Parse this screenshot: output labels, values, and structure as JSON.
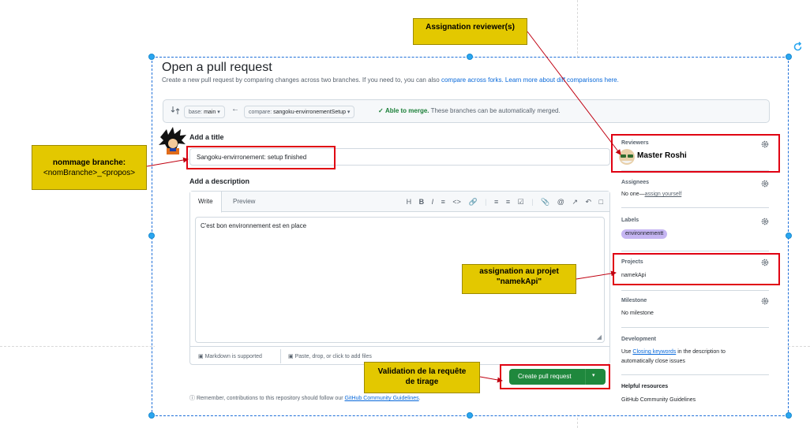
{
  "page": {
    "title": "Open a pull request",
    "subtitle_text": "Create a new pull request by comparing changes across two branches. If you need to, you can also ",
    "subtitle_link1": "compare across forks.",
    "subtitle_link2": "Learn more about diff comparisons here."
  },
  "compare": {
    "base_prefix": "base: ",
    "base_value": "main",
    "compare_prefix": "compare: ",
    "compare_value": "sangoku-envirronementSetup",
    "merge_status": "Able to merge.",
    "merge_note": "These branches can be automatically merged."
  },
  "form": {
    "title_label": "Add a title",
    "title_value": "Sangoku-envirronement: setup finished",
    "description_label": "Add a description",
    "tab_write": "Write",
    "tab_preview": "Preview",
    "description_value": "C'est bon environnement est en place",
    "markdown_note": "Markdown is supported",
    "attach_note": "Paste, drop, or click to add files",
    "create_button": "Create pull request",
    "remember_text": "Remember, contributions to this repository should follow our ",
    "remember_link": "GitHub Community Guidelines",
    "remember_end": "."
  },
  "toolbar": [
    "H",
    "B",
    "I",
    "quote",
    "code",
    "link",
    "|",
    "ordered-list",
    "unordered-list",
    "task-list",
    "|",
    "attach",
    "mention",
    "reference",
    "undo",
    "fullscreen"
  ],
  "sidebar": {
    "reviewers_label": "Reviewers",
    "reviewer_name": "Master Roshi",
    "assignees_label": "Assignees",
    "assignees_text": "No one—",
    "assignees_link": "assign yourself",
    "labels_label": "Labels",
    "label_value": "environnementt",
    "projects_label": "Projects",
    "project_value": "namekApi",
    "milestone_label": "Milestone",
    "milestone_value": "No milestone",
    "development_label": "Development",
    "development_pre": "Use ",
    "development_link": "Closing keywords",
    "development_post": " in the description to",
    "development_line2": "automatically close issues",
    "help_label": "Helpful resources",
    "help_link": "GitHub Community Guidelines"
  },
  "annotations": {
    "reviewer": "Assignation reviewer(s)",
    "branch_line1": "nommage branche:",
    "branch_line2": "<nomBranche>_<propos>",
    "project_line1": "assignation au projet",
    "project_line2": "\"namekApi\"",
    "validation_line1": "Validation de la requête",
    "validation_line2": "de tirage"
  },
  "colors": {
    "annotation_fill": "#e3c800",
    "highlight_border": "#e00012",
    "primary_button": "#1f883d",
    "link": "#0969da",
    "selection_handle": "#2aa6f0"
  }
}
